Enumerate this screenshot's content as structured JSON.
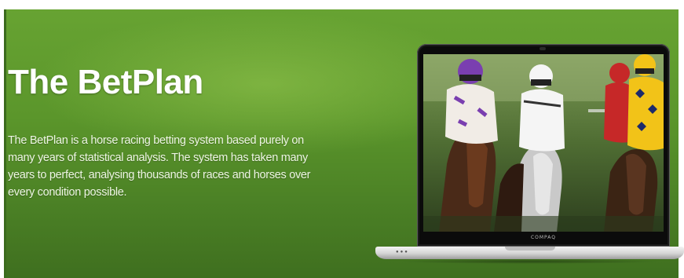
{
  "hero": {
    "title": "The BetPlan",
    "description": "The BetPlan is a horse racing betting system based purely on many years of statistical analysis. The system has taken many years to perfect, analysing thousands of races and horses over every condition possible."
  },
  "laptop": {
    "brand": "COMPAQ"
  },
  "colors": {
    "banner_green": "#5b962b",
    "banner_green_dark": "#3f6f1f",
    "title_text": "#ffffff"
  },
  "icons": {
    "laptop": "laptop-icon",
    "photo": "horse-racing-photo"
  }
}
